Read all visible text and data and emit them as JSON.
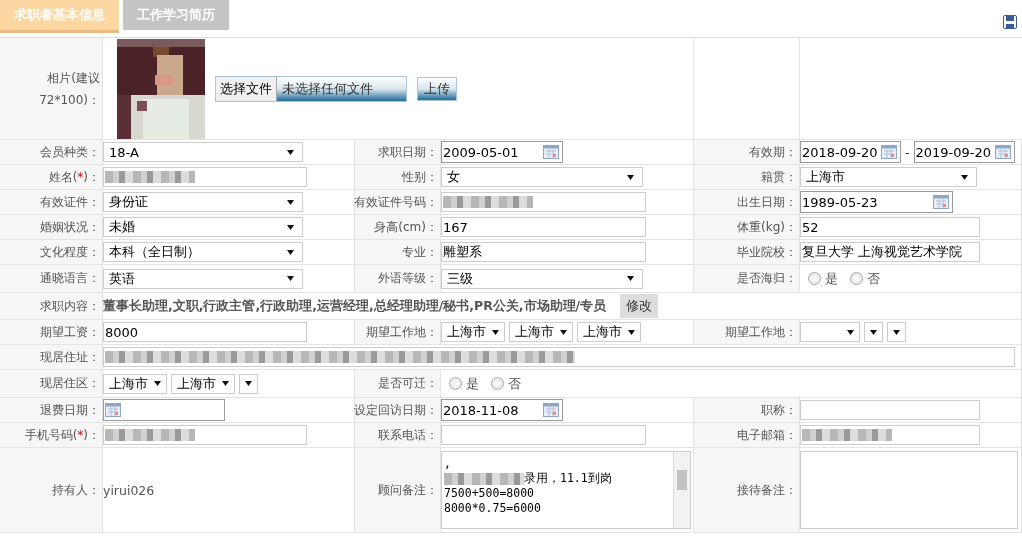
{
  "tabs": [
    {
      "label": "求职者基本信息",
      "selected": true
    },
    {
      "label": "工作学习简历",
      "selected": false
    }
  ],
  "photo": {
    "label": "相片(建议72*100)：",
    "choose_button": "选择文件",
    "file_status": "未选择任何文件",
    "upload_button": "上传"
  },
  "rows": [
    {
      "fields": [
        {
          "label": "会员种类：",
          "kind": "select",
          "value": "18-A"
        },
        {
          "label": "求职日期：",
          "kind": "date",
          "value": "2009-05-01"
        },
        {
          "label": "有效期：",
          "kind": "daterange",
          "values": [
            "2018-09-20",
            "2019-09-20"
          ],
          "separator": "-"
        }
      ]
    },
    {
      "fields": [
        {
          "label": "姓名(",
          "required": "*",
          "label_end": ")：",
          "kind": "text",
          "redacted": true
        },
        {
          "label": "性别：",
          "kind": "select",
          "value": "女"
        },
        {
          "label": "籍贯：",
          "kind": "select",
          "value": "上海市"
        }
      ]
    },
    {
      "fields": [
        {
          "label": "有效证件：",
          "kind": "select",
          "value": "身份证"
        },
        {
          "label": "有效证件号码：",
          "kind": "text",
          "redacted": true
        },
        {
          "label": "出生日期：",
          "kind": "date",
          "value": "1989-05-23"
        }
      ]
    },
    {
      "fields": [
        {
          "label": "婚姻状况：",
          "kind": "select",
          "value": "未婚"
        },
        {
          "label": "身高(cm)：",
          "kind": "text",
          "value": "167"
        },
        {
          "label": "体重(kg)：",
          "kind": "text",
          "value": "52"
        }
      ]
    },
    {
      "fields": [
        {
          "label": "文化程度：",
          "kind": "select",
          "value": "本科（全日制）"
        },
        {
          "label": "专业：",
          "kind": "text",
          "value": "雕塑系"
        },
        {
          "label": "毕业院校：",
          "kind": "text",
          "value": "复旦大学 上海视觉艺术学院"
        }
      ]
    },
    {
      "fields": [
        {
          "label": "通晓语言：",
          "kind": "select",
          "value": "英语"
        },
        {
          "label": "外语等级：",
          "kind": "select",
          "value": "三级"
        },
        {
          "label": "是否海归：",
          "kind": "radio",
          "options": [
            {
              "label": "是",
              "selected": false
            },
            {
              "label": "否",
              "selected": false
            }
          ]
        }
      ]
    },
    {
      "fields": [
        {
          "label": "求职内容：",
          "kind": "jobs",
          "value": "董事长助理,文职,行政主管,行政助理,运营经理,总经理助理/秘书,PR公关,市场助理/专员",
          "button": "修改"
        }
      ]
    },
    {
      "fields": [
        {
          "label": "期望工资：",
          "kind": "text",
          "value": "8000"
        },
        {
          "label": "期望工作地：",
          "kind": "selects",
          "selects": [
            {
              "value": "上海市"
            },
            {
              "value": "上海市"
            },
            {
              "value": "上海市"
            }
          ]
        },
        {
          "label": "期望工作地：",
          "kind": "selects",
          "selects": [
            {
              "blank": true
            },
            {
              "blank": true
            },
            {
              "blank": true
            }
          ]
        }
      ]
    },
    {
      "fields": [
        {
          "label": "现居住址：",
          "kind": "text",
          "redacted": true
        }
      ]
    },
    {
      "fields": [
        {
          "label": "现居住区：",
          "kind": "selects",
          "selects": [
            {
              "value": "上海市"
            },
            {
              "value": "上海市"
            },
            {
              "blank": true
            }
          ]
        },
        {
          "label": "是否可迁：",
          "kind": "radio",
          "options": [
            {
              "label": "是",
              "selected": false
            },
            {
              "label": "否",
              "selected": false
            }
          ]
        }
      ]
    },
    {
      "fields": [
        {
          "label": "退费日期：",
          "kind": "date"
        },
        {
          "label": "设定回访日期：",
          "kind": "date",
          "value": "2018-11-08"
        },
        {
          "label": "职称：",
          "kind": "text"
        }
      ]
    },
    {
      "fields": [
        {
          "label": "手机号码(",
          "required": "*",
          "label_end": ")：",
          "kind": "text",
          "redacted": true
        },
        {
          "label": "联系电话：",
          "kind": "text"
        },
        {
          "label": "电子邮箱：",
          "kind": "text",
          "redacted": true
        }
      ]
    },
    {
      "fields": [
        {
          "label": "持有人：",
          "kind": "plain",
          "value": "yirui026"
        },
        {
          "label": "顾问备注：",
          "kind": "textarea",
          "lines": [
            {
              "text": ","
            },
            {
              "redacted": true,
              "text": "录用，11.1到岗"
            },
            {
              "text": "7500+500=8000"
            },
            {
              "text": "8000*0.75=6000"
            }
          ]
        },
        {
          "label": "接待备注：",
          "kind": "textarea"
        }
      ]
    }
  ]
}
